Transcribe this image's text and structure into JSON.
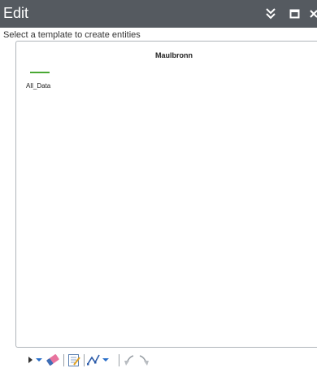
{
  "window": {
    "title": "Edit"
  },
  "header": {
    "subtitle": "Select a template to create entities"
  },
  "templates": {
    "layer_name": "Maulbronn",
    "items": [
      {
        "label": "All_Data",
        "color": "#49a833"
      }
    ]
  },
  "titlebar_icons": [
    "chevrons-down-icon",
    "maximize-icon",
    "close-icon"
  ],
  "toolbar_icons": [
    "select-arrow-icon",
    "dropdown-icon",
    "eraser-icon",
    "attributes-icon",
    "reshape-line-icon",
    "dropdown-icon",
    "undo-icon",
    "redo-icon"
  ],
  "colors": {
    "titlebar_bg": "#555a60",
    "accent_green": "#49a833"
  }
}
